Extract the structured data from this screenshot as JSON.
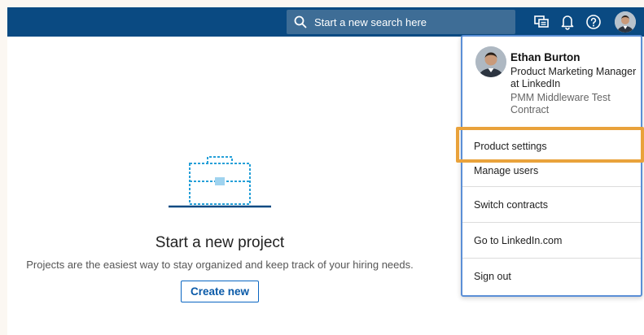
{
  "search": {
    "placeholder": "Start a new search here",
    "icon": "search-icon"
  },
  "topbar": {
    "icons": [
      "messages-icon",
      "notifications-bell-icon",
      "help-icon",
      "profile-avatar"
    ]
  },
  "empty_state": {
    "title": "Start a new project",
    "subtitle": "Projects are the easiest way to stay organized and keep track of your hiring needs.",
    "button": "Create new",
    "illustration": "briefcase-icon"
  },
  "profile": {
    "name": "Ethan Burton",
    "title": "Product Marketing Manager at LinkedIn",
    "contract": "PMM Middleware Test Contract"
  },
  "menu": {
    "items": [
      {
        "label": "Product settings",
        "highlighted": true
      },
      {
        "label": "Manage users"
      },
      {
        "label": "Switch contracts"
      },
      {
        "label": "Go to LinkedIn.com"
      },
      {
        "label": "Sign out"
      }
    ]
  },
  "colors": {
    "topbar": "#0a4a82",
    "search_bg": "#3e6d96",
    "accent": "#0a66c2",
    "highlight": "#e9a23b",
    "dropdown_border": "#5b8fd6"
  }
}
